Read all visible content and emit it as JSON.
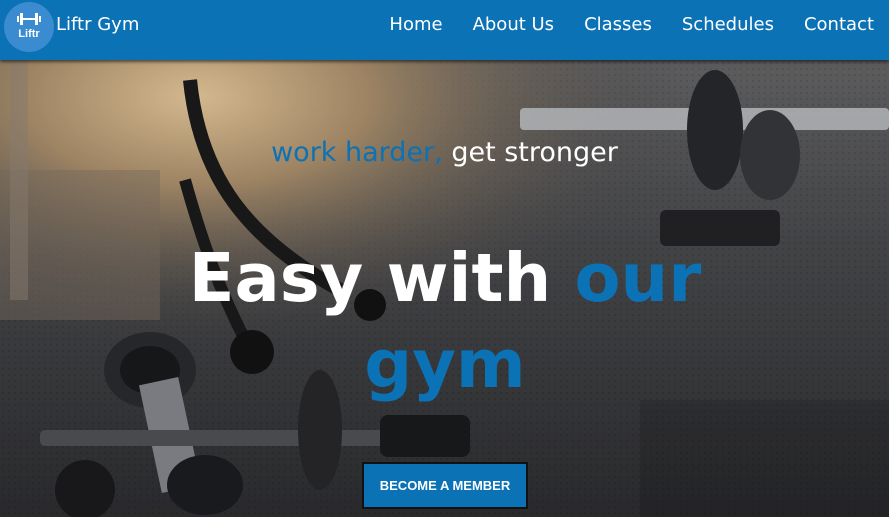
{
  "brand": {
    "logo_text": "Liftr",
    "logo_icon": "dumbbell-icon",
    "name": "Liftr Gym"
  },
  "nav": {
    "items": [
      {
        "label": "Home"
      },
      {
        "label": "About Us"
      },
      {
        "label": "Classes"
      },
      {
        "label": "Schedules"
      },
      {
        "label": "Contact"
      }
    ]
  },
  "hero": {
    "tagline_accent": "work harder,",
    "tagline_rest": " get stronger",
    "headline_white": "Easy with ",
    "headline_accent": "our gym",
    "cta_label": "BECOME A MEMBER"
  },
  "colors": {
    "primary": "#0b72b5",
    "text": "#ffffff"
  }
}
